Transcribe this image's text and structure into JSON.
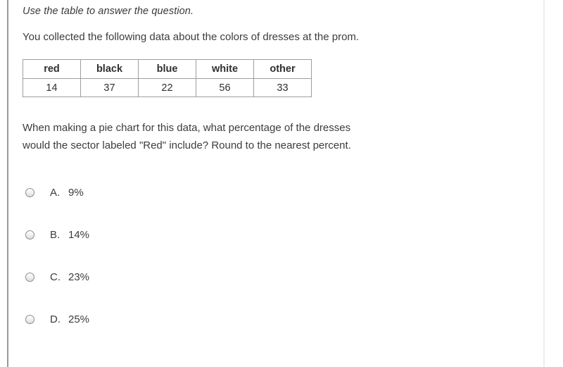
{
  "instruction": "Use the table to answer the question.",
  "intro": "You collected the following data about the colors of dresses at the prom.",
  "table": {
    "headers": [
      "red",
      "black",
      "blue",
      "white",
      "other"
    ],
    "values": [
      "14",
      "37",
      "22",
      "56",
      "33"
    ]
  },
  "question": "When making a pie chart for this data, what percentage of the dresses would the sector labeled \"Red\" include? Round to the nearest percent.",
  "options": [
    {
      "letter": "A.",
      "value": "9%"
    },
    {
      "letter": "B.",
      "value": "14%"
    },
    {
      "letter": "C.",
      "value": "23%"
    },
    {
      "letter": "D.",
      "value": "25%"
    }
  ],
  "colors": {
    "text": "#3c3c3c",
    "rule": "#9a9a9a",
    "table_border": "#9e9e9e"
  }
}
